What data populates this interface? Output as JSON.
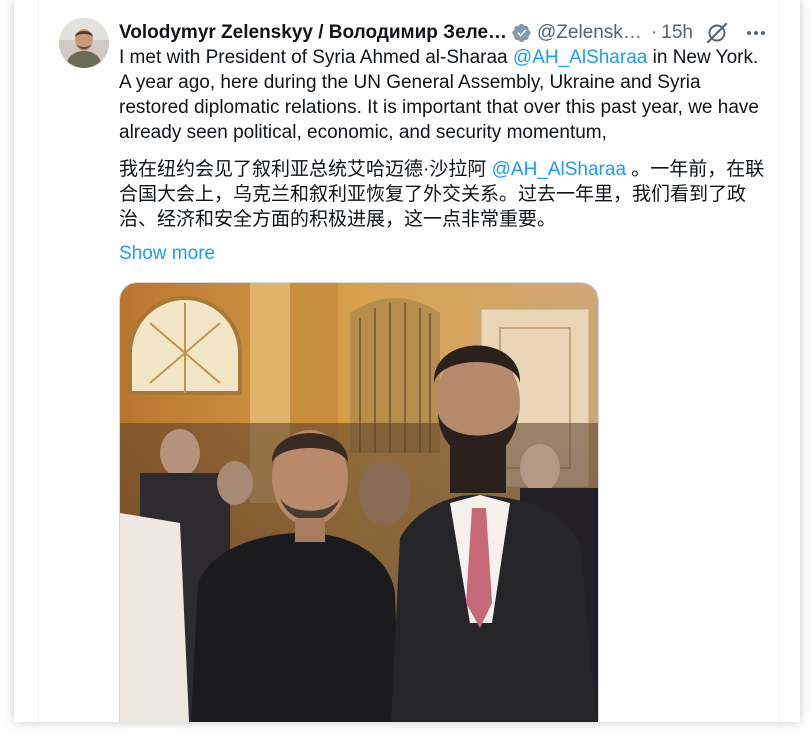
{
  "post": {
    "author_name": "Volodymyr Zelenskyy / Володимир Зелен...",
    "handle": "@Zelensky...",
    "separator": "·",
    "time": "15h",
    "text_en_before": "I met with President of Syria Ahmed al-Sharaa ",
    "mention": "@AH_AlSharaa",
    "text_en_after": " in New York. A year ago, here during the UN General Assembly, Ukraine and Syria restored diplomatic relations. It is important that over this past year, we have already seen political, economic, and security momentum,",
    "text_zh_before": "我在纽约会见了叙利亚总统艾哈迈德·沙拉阿 ",
    "text_zh_after": " 。一年前，在联合国大会上，乌克兰和叙利亚恢复了外交关系。过去一年里，我们看到了政治、经济和安全方面的积极进展，这一点非常重要。",
    "show_more": "Show more"
  },
  "icons": {
    "verified": "verified-badge-icon",
    "grok": "grok-icon",
    "more": "more-options-icon"
  },
  "colors": {
    "link": "#1d9bf0",
    "text": "#0f1419",
    "secondary": "#536471",
    "border": "#eff3f4"
  }
}
